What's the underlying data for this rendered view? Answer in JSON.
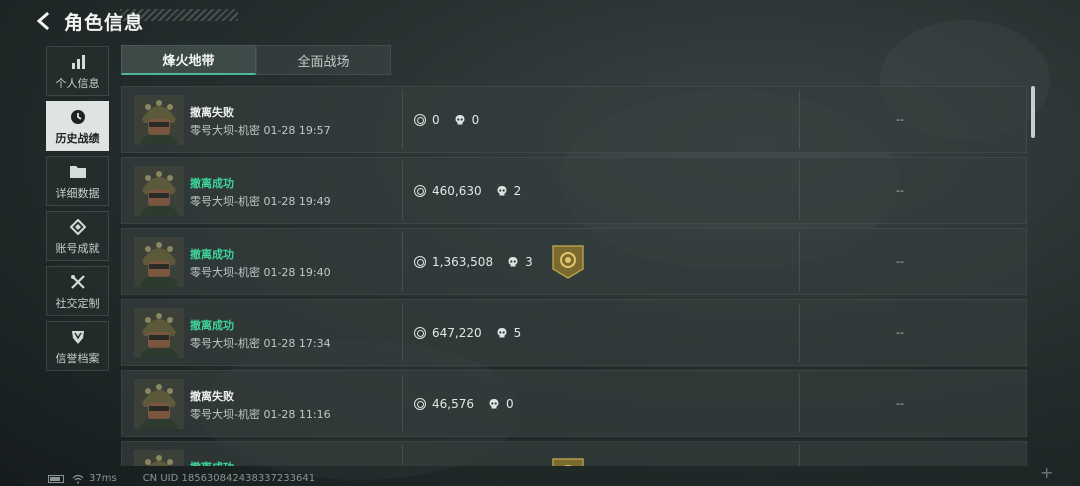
{
  "header": {
    "title": "角色信息"
  },
  "sidebar": {
    "items": [
      {
        "label": "个人信息",
        "icon": "bar-chart-icon",
        "active": false
      },
      {
        "label": "历史战绩",
        "icon": "clock-icon",
        "active": true
      },
      {
        "label": "详细数据",
        "icon": "folder-icon",
        "active": false
      },
      {
        "label": "账号成就",
        "icon": "medal-icon",
        "active": false
      },
      {
        "label": "社交定制",
        "icon": "tools-icon",
        "active": false
      },
      {
        "label": "信誉档案",
        "icon": "shield-icon",
        "active": false
      }
    ]
  },
  "tabs": [
    {
      "label": "烽火地带",
      "active": true
    },
    {
      "label": "全面战场",
      "active": false
    }
  ],
  "records": [
    {
      "status": "撤离失败",
      "success": false,
      "map_time": "零号大坝-机密 01-28 19:57",
      "value": "0",
      "kills": "0",
      "badge": false,
      "extra": "--"
    },
    {
      "status": "撤离成功",
      "success": true,
      "map_time": "零号大坝-机密 01-28 19:49",
      "value": "460,630",
      "kills": "2",
      "badge": false,
      "extra": "--"
    },
    {
      "status": "撤离成功",
      "success": true,
      "map_time": "零号大坝-机密 01-28 19:40",
      "value": "1,363,508",
      "kills": "3",
      "badge": true,
      "extra": "--"
    },
    {
      "status": "撤离成功",
      "success": true,
      "map_time": "零号大坝-机密 01-28 17:34",
      "value": "647,220",
      "kills": "5",
      "badge": false,
      "extra": "--"
    },
    {
      "status": "撤离失败",
      "success": false,
      "map_time": "零号大坝-机密 01-28 11:16",
      "value": "46,576",
      "kills": "0",
      "badge": false,
      "extra": "--"
    },
    {
      "status": "撤离成功",
      "success": true,
      "map_time": "",
      "value": "",
      "kills": "",
      "badge": true,
      "extra": ""
    }
  ],
  "footer": {
    "ping": "37ms",
    "uid": "CN UID 18563084243833723364​1"
  },
  "colors": {
    "success": "#3ed49a",
    "accent": "#4fb89a",
    "active_nav_bg": "#dfe4e2"
  }
}
